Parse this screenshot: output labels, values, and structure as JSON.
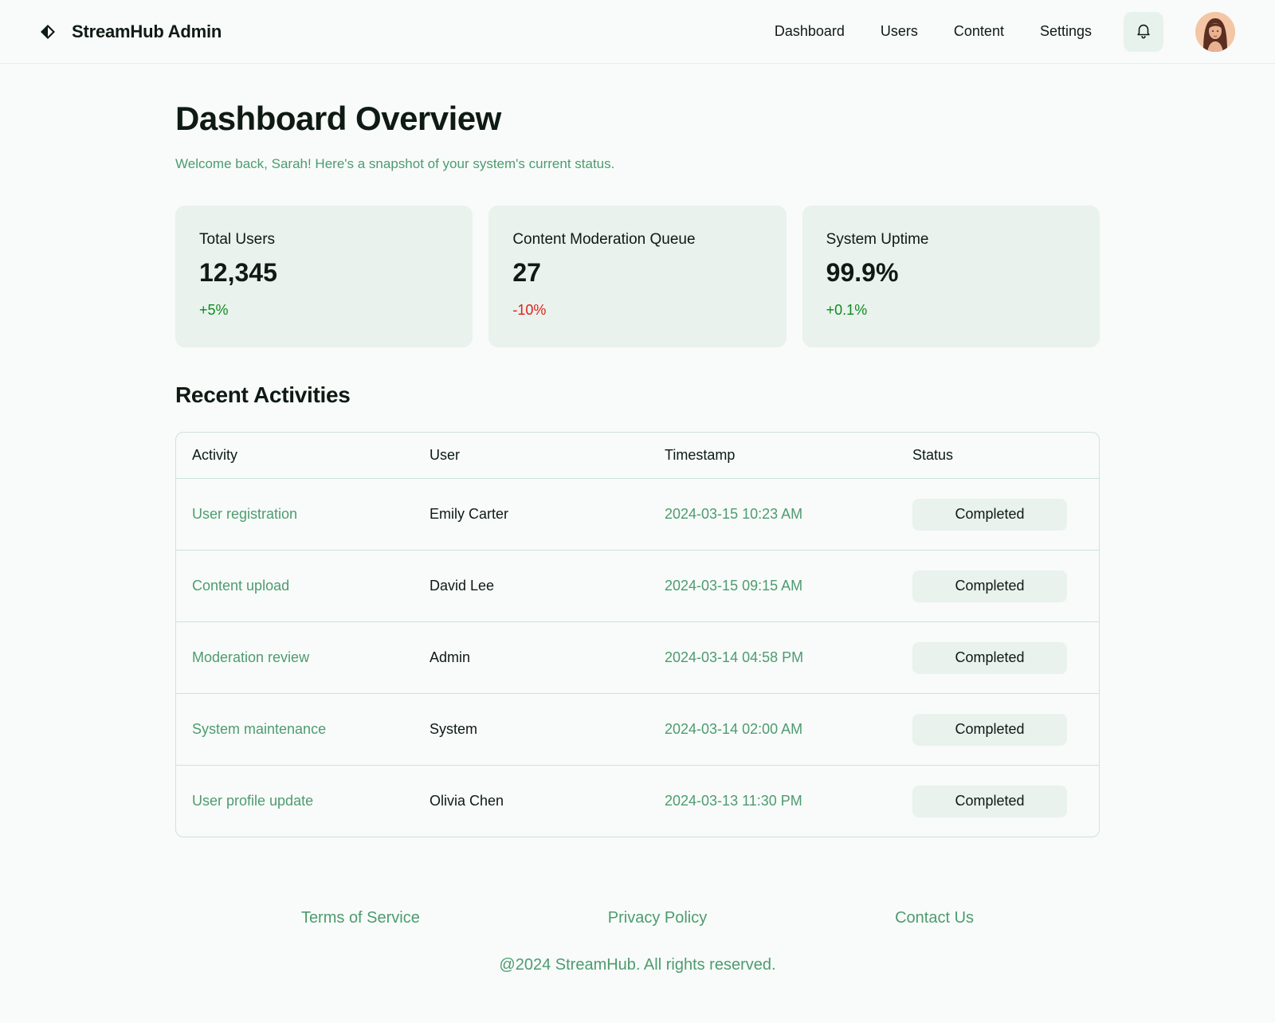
{
  "header": {
    "brand_title": "StreamHub Admin",
    "brand_icon": "diamond-logo-icon",
    "nav": [
      "Dashboard",
      "Users",
      "Content",
      "Settings"
    ],
    "bell_icon": "bell-icon",
    "avatar": "user-avatar"
  },
  "main": {
    "title": "Dashboard Overview",
    "subtitle": "Welcome back, Sarah! Here's a snapshot of your system's current status.",
    "cards": [
      {
        "label": "Total Users",
        "value": "12,345",
        "delta": "+5%",
        "delta_color": "#0f8a1f"
      },
      {
        "label": "Content Moderation Queue",
        "value": "27",
        "delta": "-10%",
        "delta_color": "#e0201a"
      },
      {
        "label": "System Uptime",
        "value": "99.9%",
        "delta": "+0.1%",
        "delta_color": "#0f8a1f"
      }
    ],
    "activities_title": "Recent Activities",
    "table": {
      "headers": [
        "Activity",
        "User",
        "Timestamp",
        "Status"
      ],
      "rows": [
        {
          "activity": "User registration",
          "user": "Emily Carter",
          "timestamp": "2024-03-15 10:23 AM",
          "status": "Completed"
        },
        {
          "activity": "Content upload",
          "user": "David Lee",
          "timestamp": "2024-03-15 09:15 AM",
          "status": "Completed"
        },
        {
          "activity": "Moderation review",
          "user": "Admin",
          "timestamp": "2024-03-14 04:58 PM",
          "status": "Completed"
        },
        {
          "activity": "System maintenance",
          "user": "System",
          "timestamp": "2024-03-14 02:00 AM",
          "status": "Completed"
        },
        {
          "activity": "User profile update",
          "user": "Olivia Chen",
          "timestamp": "2024-03-13 11:30 PM",
          "status": "Completed"
        }
      ]
    }
  },
  "footer": {
    "links": [
      "Terms of Service",
      "Privacy Policy",
      "Contact Us"
    ],
    "copyright": "@2024 StreamHub. All rights reserved."
  },
  "colors": {
    "accent_text": "#4e9b6f",
    "card_bg": "#e9f2ed",
    "positive": "#0f8a1f",
    "negative": "#e0201a"
  }
}
